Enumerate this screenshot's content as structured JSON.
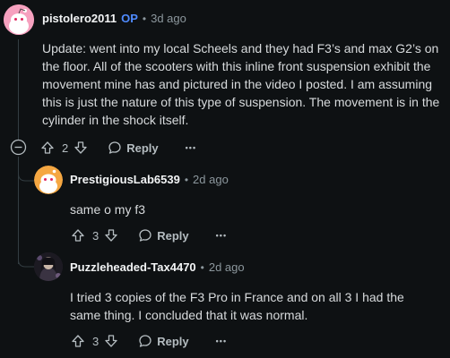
{
  "comments": [
    {
      "author": "pistolero2011",
      "op_badge": "OP",
      "separator": "•",
      "time": "3d ago",
      "body": "Update: went into my local Scheels and they had F3’s and max G2’s on the floor. All of the scooters with this inline front suspension exhibit the movement mine has and pictured in the video I posted. I am assuming this is just the nature of this type of suspension. The movement is in the cylinder in the shock itself.",
      "votes": "2",
      "reply_label": "Reply",
      "more_label": "•••"
    },
    {
      "author": "PrestigiousLab6539",
      "separator": "•",
      "time": "2d ago",
      "body": "same o my f3",
      "votes": "3",
      "reply_label": "Reply",
      "more_label": "•••"
    },
    {
      "author": "Puzzleheaded-Tax4470",
      "separator": "•",
      "time": "2d ago",
      "body": "I tried 3 copies of the F3 Pro in France and on all 3 I had the same thing. I concluded that it was normal.",
      "votes": "3",
      "reply_label": "Reply",
      "more_label": "•••"
    }
  ],
  "colors": {
    "background": "#0e1113",
    "op": "#4f8bff",
    "thread_line": "#333d42"
  },
  "icons": [
    "snoo-avatar-pink",
    "snoo-avatar-orange",
    "user-avatar-photo",
    "upvote-icon",
    "downvote-icon",
    "reply-bubble-icon",
    "collapse-icon"
  ]
}
